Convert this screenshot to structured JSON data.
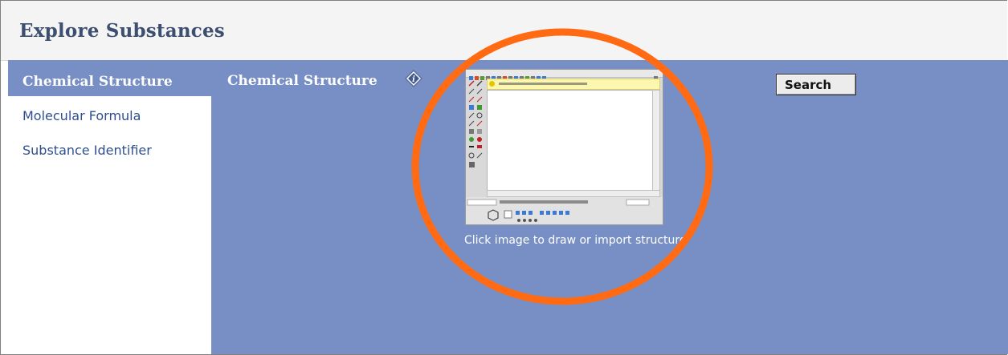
{
  "header": {
    "title": "Explore Substances"
  },
  "sidebar": {
    "items": [
      {
        "label": "Chemical Structure",
        "active": true
      },
      {
        "label": "Molecular Formula",
        "active": false
      },
      {
        "label": "Substance Identifier",
        "active": false
      }
    ]
  },
  "main": {
    "heading": "Chemical Structure",
    "info_icon": "info-diamond-icon",
    "caption": "Click image to draw or import structure",
    "search_label": "Search"
  },
  "annotation": {
    "color": "#ff6a13",
    "shape": "ellipse"
  },
  "colors": {
    "panel": "#788fc5",
    "header_bg": "#f4f4f4",
    "title": "#3c4f70",
    "link": "#2f4f8f"
  }
}
